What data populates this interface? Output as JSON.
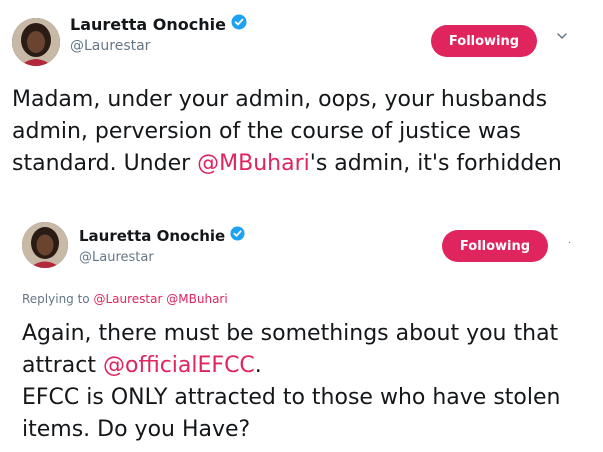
{
  "tweet1": {
    "author": {
      "display_name": "Lauretta Onochie",
      "handle": "@Laurestar",
      "verified": true
    },
    "follow_button_label": "Following",
    "caret_icon": "chevron-down-icon",
    "text_before": "Madam, under your admin, oops, your husbands admin, perversion of the course of justice was standard. Under ",
    "mention": "@MBuhari",
    "text_after": "'s admin, it's forhidden"
  },
  "tweet2": {
    "author": {
      "display_name": "Lauretta Onochie",
      "handle": "@Laurestar",
      "verified": true
    },
    "follow_button_label": "Following",
    "reply": {
      "prefix": "Replying to",
      "mentions": [
        "@Laurestar",
        "@MBuhari"
      ]
    },
    "text_before": "Again, there must be somethings about you that attract ",
    "mention": "@officialEFCC",
    "text_after": ".\nEFCC is ONLY attracted to those who have stolen items. Do you Have?"
  },
  "colors": {
    "accent": "#e0245e",
    "verified_blue": "#1da1f2",
    "secondary_text": "#657786",
    "primary_text": "#14171a"
  }
}
